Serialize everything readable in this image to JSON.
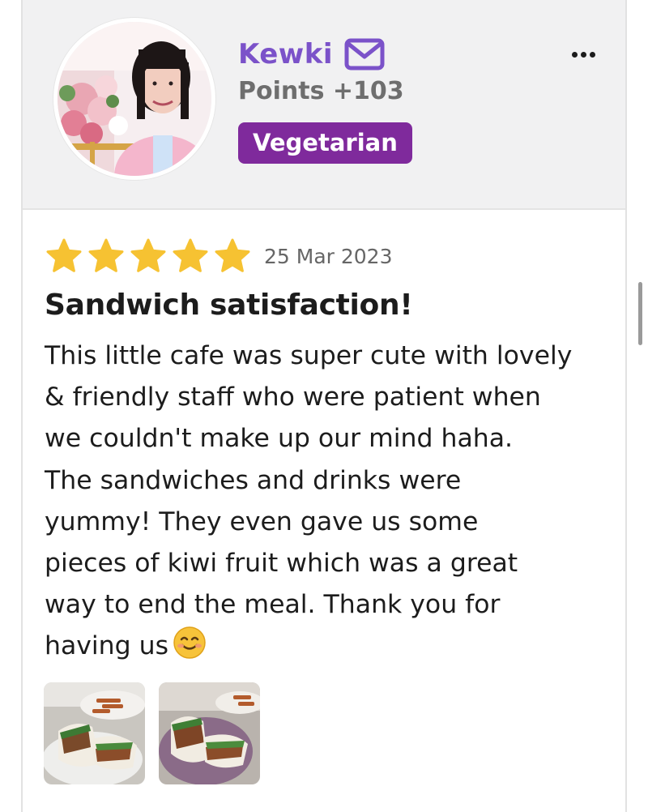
{
  "user": {
    "name": "Kewki",
    "points": "Points +103",
    "badge": "Vegetarian",
    "avatar_alt": "profile-photo"
  },
  "review": {
    "rating": 5,
    "rating_max": 5,
    "date": "25 Mar 2023",
    "title": "Sandwich satisfaction!",
    "body": "This little cafe was super cute with lovely\n& friendly staff who were patient when\nwe couldn't make up our mind haha.\nThe sandwiches and drinks were\nyummy! They even gave us some\npieces of kiwi fruit which was a great\nway to end the meal. Thank you for\nhaving us",
    "emoji": "smiling-face-emoji",
    "photos": [
      "sandwich-photo-1",
      "sandwich-photo-2"
    ]
  },
  "icons": {
    "mail": "mail-icon",
    "more": "more-options-icon",
    "star": "star-icon"
  },
  "colors": {
    "username": "#7b52c9",
    "badge_bg": "#7f2a9c",
    "star": "#f6c232",
    "header_bg": "#f1f1f2"
  }
}
